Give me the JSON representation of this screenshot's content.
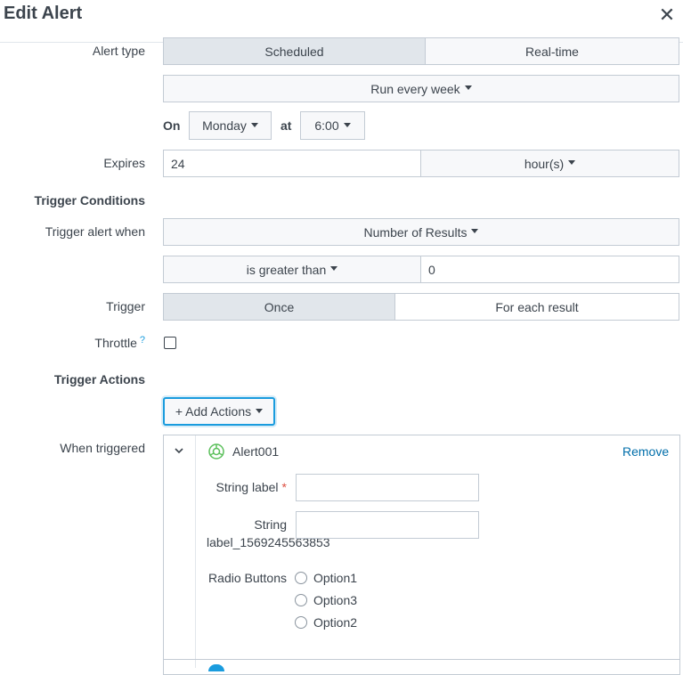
{
  "header": {
    "title": "Edit Alert",
    "close_glyph": "✕"
  },
  "alert_type": {
    "label": "Alert type",
    "options": [
      "Scheduled",
      "Real-time"
    ],
    "selected": "Scheduled"
  },
  "schedule": {
    "frequency": "Run every week",
    "on_label": "On",
    "day": "Monday",
    "at_label": "at",
    "time": "6:00"
  },
  "expires": {
    "label": "Expires",
    "value": "24",
    "unit": "hour(s)"
  },
  "trigger_conditions": {
    "heading": "Trigger Conditions",
    "when_label": "Trigger alert when",
    "when_value": "Number of Results",
    "comparator": "is greater than",
    "threshold": "0",
    "trigger_label": "Trigger",
    "trigger_options": [
      "Once",
      "For each result"
    ],
    "trigger_selected": "Once",
    "throttle_label": "Throttle",
    "throttle_help": "?",
    "throttle_checked": false
  },
  "trigger_actions": {
    "heading": "Trigger Actions",
    "add_label": "+ Add Actions",
    "when_triggered_label": "When triggered"
  },
  "action": {
    "name": "Alert001",
    "remove_label": "Remove",
    "string_label": "String label",
    "required_marker": "*",
    "string_label2_line1": "String",
    "string_label2_line2": "label_1569245563853",
    "string_value": "",
    "string_value2": "",
    "radio_label": "Radio Buttons",
    "radio_options": [
      "Option1",
      "Option3",
      "Option2"
    ]
  },
  "colors": {
    "accent": "#1a9cde",
    "link": "#006eaa",
    "border": "#c3cbd4",
    "active_bg": "#e1e6eb"
  }
}
